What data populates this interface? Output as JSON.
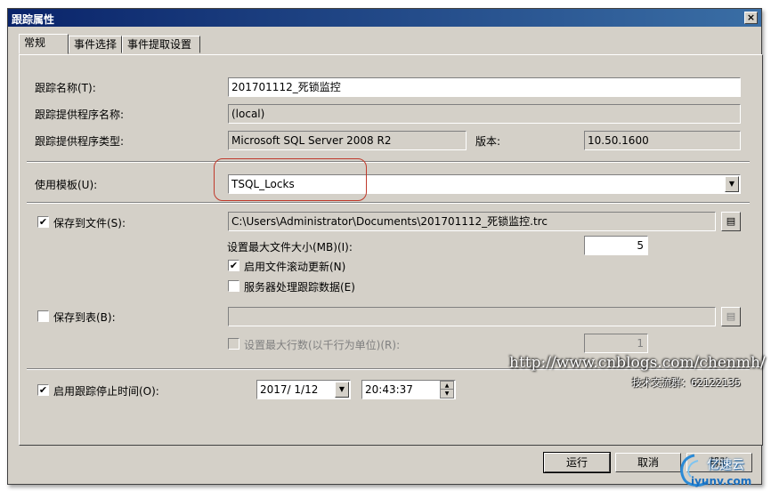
{
  "window": {
    "title": "跟踪属性",
    "close_glyph": "×"
  },
  "tabs": [
    {
      "label": "常规",
      "active": true
    },
    {
      "label": "事件选择",
      "active": false
    },
    {
      "label": "事件提取设置",
      "active": false
    }
  ],
  "general": {
    "trace_name_label": "跟踪名称(T):",
    "trace_name_value": "201701112_死锁监控",
    "provider_name_label": "跟踪提供程序名称:",
    "provider_name_value": "(local)",
    "provider_type_label": "跟踪提供程序类型:",
    "provider_type_value": "Microsoft SQL Server 2008 R2",
    "version_label": "版本:",
    "version_value": "10.50.1600",
    "template_label": "使用模板(U):",
    "template_value": "TSQL_Locks"
  },
  "save_to_file": {
    "label": "保存到文件(S):",
    "checked": true,
    "path_value": "C:\\Users\\Administrator\\Documents\\201701112_死锁监控.trc",
    "max_size_label": "设置最大文件大小(MB)(I):",
    "max_size_value": "5",
    "rollover_label": "启用文件滚动更新(N)",
    "rollover_checked": true,
    "server_process_label": "服务器处理跟踪数据(E)",
    "server_process_checked": false
  },
  "save_to_table": {
    "label": "保存到表(B):",
    "checked": false,
    "table_value": "",
    "max_rows_label": "设置最大行数(以千行为单位)(R):",
    "max_rows_checked": false,
    "max_rows_value": "1"
  },
  "stop_time": {
    "label": "启用跟踪停止时间(O):",
    "checked": true,
    "date_value": "2017/ 1/12",
    "time_value": "20:43:37"
  },
  "buttons": {
    "run": "运行",
    "cancel": "取消",
    "help": "帮助"
  },
  "watermark": {
    "url": "http://www.cnblogs.com/chenmh/",
    "qq": "技术交流群：62122135"
  },
  "logo": {
    "text": "亿速云",
    "url": "iyunv.com"
  },
  "icons": {
    "check": "✔",
    "dropdown": "▼",
    "spin_up": "▲",
    "spin_down": "▼",
    "browse": "browse-file-icon"
  },
  "colors": {
    "title_bar": "#0a246a",
    "dialog_bg": "#d4d0c8",
    "highlight": "#c0392b"
  }
}
